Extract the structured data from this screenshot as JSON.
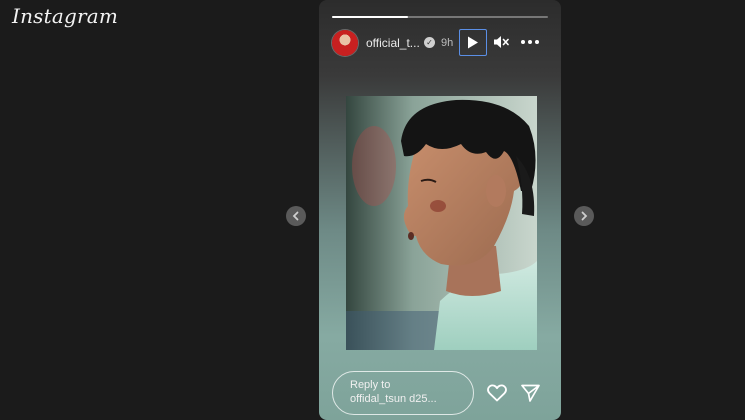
{
  "app": {
    "brand": "Instagram"
  },
  "story": {
    "progress": 0.35,
    "user": {
      "username": "official_t...",
      "verified": true,
      "time_ago": "9h"
    },
    "controls": {
      "play": "play-icon",
      "mute": "volume-muted-icon",
      "more": "more-dots-icon"
    },
    "media": {
      "description_icon": "story-photo"
    },
    "reply": {
      "placeholder_line1": "Reply to",
      "placeholder_line2": "offidal_tsun d25..."
    },
    "actions": {
      "like": "heart-icon",
      "share": "send-icon"
    }
  },
  "navigation": {
    "prev": "chevron-left-icon",
    "next": "chevron-right-icon"
  },
  "colors": {
    "background": "#1b1b1b",
    "focus_outline": "#5b8fe6",
    "text": "#eaeaea"
  }
}
